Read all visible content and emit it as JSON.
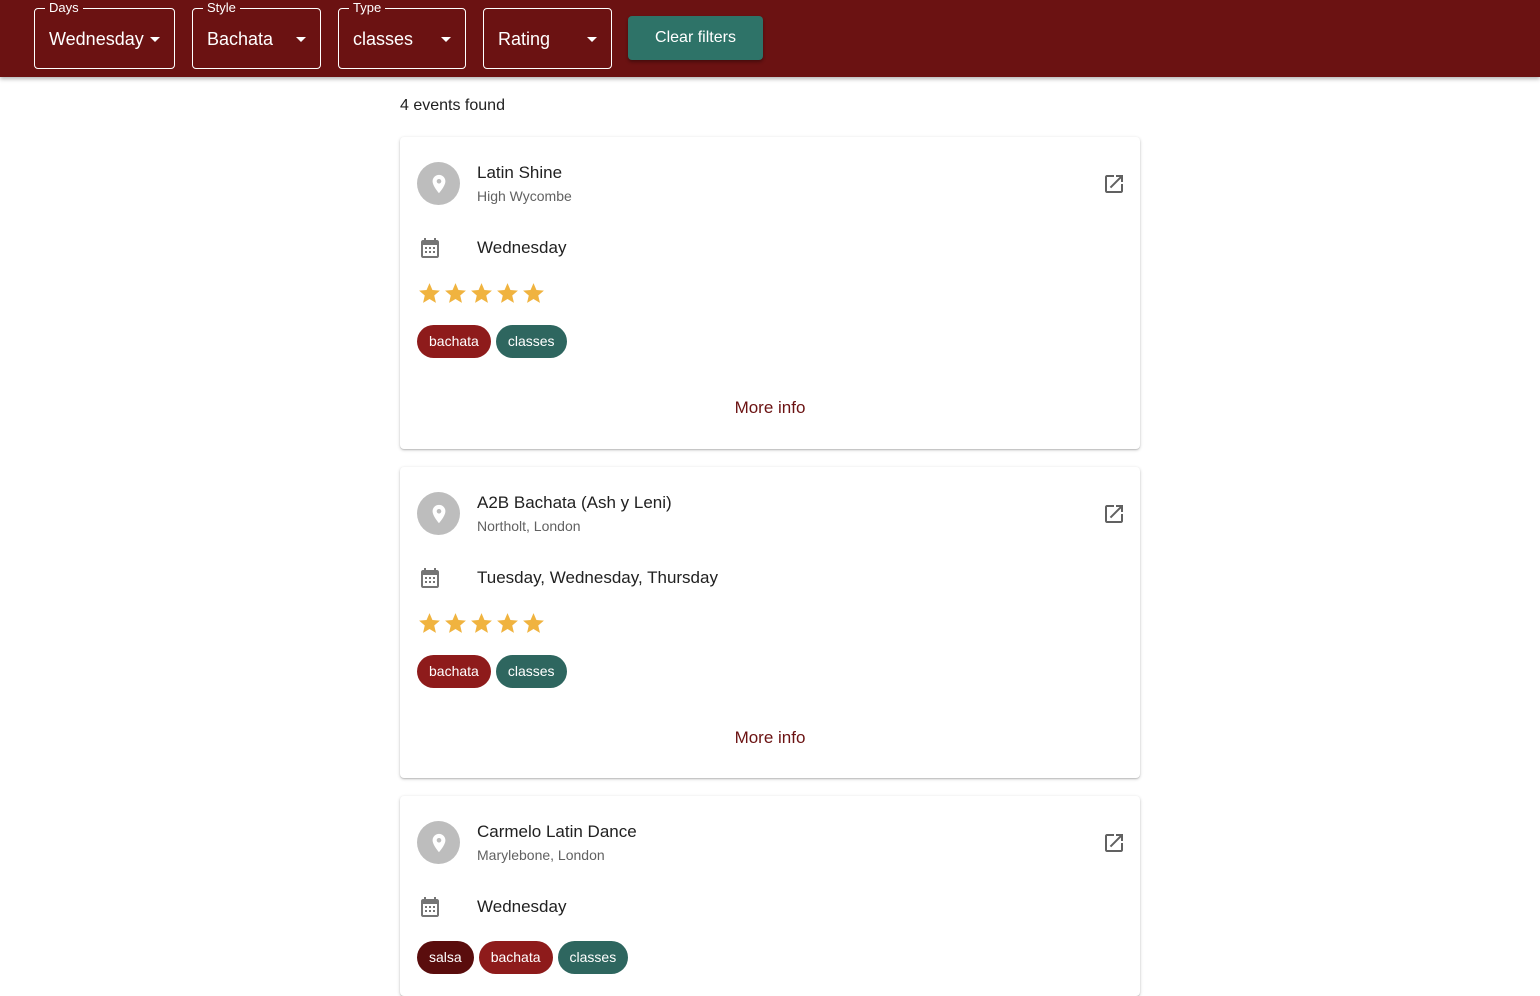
{
  "filters": {
    "days": {
      "label": "Days",
      "value": "Wednesday"
    },
    "style": {
      "label": "Style",
      "value": "Bachata"
    },
    "type": {
      "label": "Type",
      "value": "classes"
    },
    "rating": {
      "label": "",
      "value": "Rating"
    },
    "clear_label": "Clear filters"
  },
  "results": {
    "count_text": "4 events found"
  },
  "events": [
    {
      "name": "Latin Shine",
      "location": "High Wycombe",
      "days": "Wednesday",
      "rating": 5,
      "tags": [
        "bachata",
        "classes"
      ],
      "more_label": "More info"
    },
    {
      "name": "A2B Bachata (Ash y Leni)",
      "location": "Northolt, London",
      "days": "Tuesday, Wednesday, Thursday",
      "rating": 5,
      "tags": [
        "bachata",
        "classes"
      ],
      "more_label": "More info"
    },
    {
      "name": "Carmelo Latin Dance",
      "location": "Marylebone, London",
      "days": "Wednesday",
      "tags": [
        "salsa",
        "bachata",
        "classes"
      ]
    }
  ],
  "colors": {
    "header": "#6b1212",
    "accent_button": "#2e7368",
    "star": "#f0b33f",
    "tag_bachata": "#8e1b1b",
    "tag_classes": "#2e665f",
    "tag_salsa": "#5a0d0d"
  }
}
